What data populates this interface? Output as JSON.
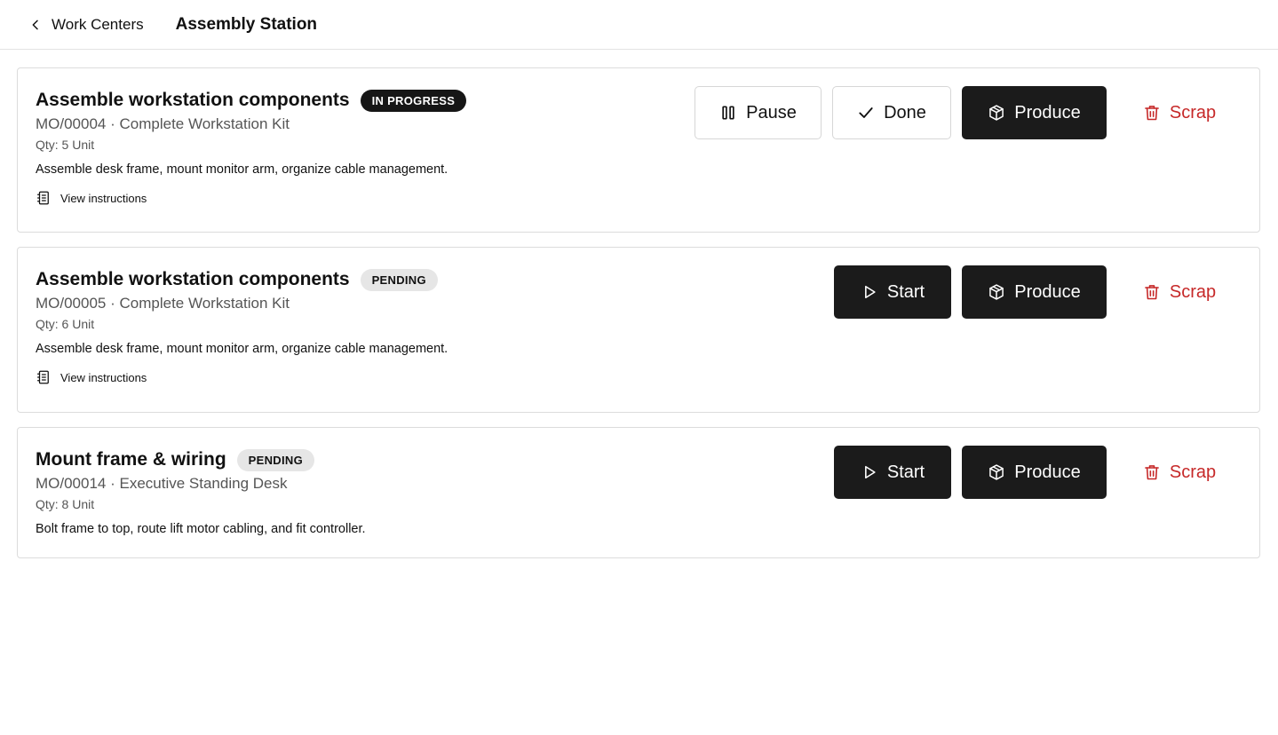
{
  "header": {
    "back_label": "Work Centers",
    "title": "Assembly Station"
  },
  "orders": [
    {
      "title": "Assemble workstation components",
      "status": "IN PROGRESS",
      "subtitle": "MO/00004 · Complete Workstation Kit",
      "qty": "Qty: 5 Unit",
      "description": "Assemble desk frame, mount monitor arm, organize cable management.",
      "instructions_label": "View instructions",
      "actions": {
        "pause": "Pause",
        "done": "Done",
        "produce": "Produce",
        "scrap": "Scrap"
      }
    },
    {
      "title": "Assemble workstation components",
      "status": "PENDING",
      "subtitle": "MO/00005 · Complete Workstation Kit",
      "qty": "Qty: 6 Unit",
      "description": "Assemble desk frame, mount monitor arm, organize cable management.",
      "instructions_label": "View instructions",
      "actions": {
        "start": "Start",
        "produce": "Produce",
        "scrap": "Scrap"
      }
    },
    {
      "title": "Mount frame & wiring",
      "status": "PENDING",
      "subtitle": "MO/00014 · Executive Standing Desk",
      "qty": "Qty: 8 Unit",
      "description": "Bolt frame to top, route lift motor cabling, and fit controller.",
      "actions": {
        "start": "Start",
        "produce": "Produce",
        "scrap": "Scrap"
      }
    }
  ],
  "icons": {
    "back": "chevron-left-icon",
    "instructions": "notebook-icon",
    "pause": "pause-icon",
    "done": "check-icon",
    "start": "play-icon",
    "produce": "package-icon",
    "scrap": "trash-icon"
  },
  "colors": {
    "primary_button": "#1b1b1b",
    "danger": "#c62828",
    "badge_in_progress": "#161616",
    "badge_pending": "#e6e6e6"
  }
}
